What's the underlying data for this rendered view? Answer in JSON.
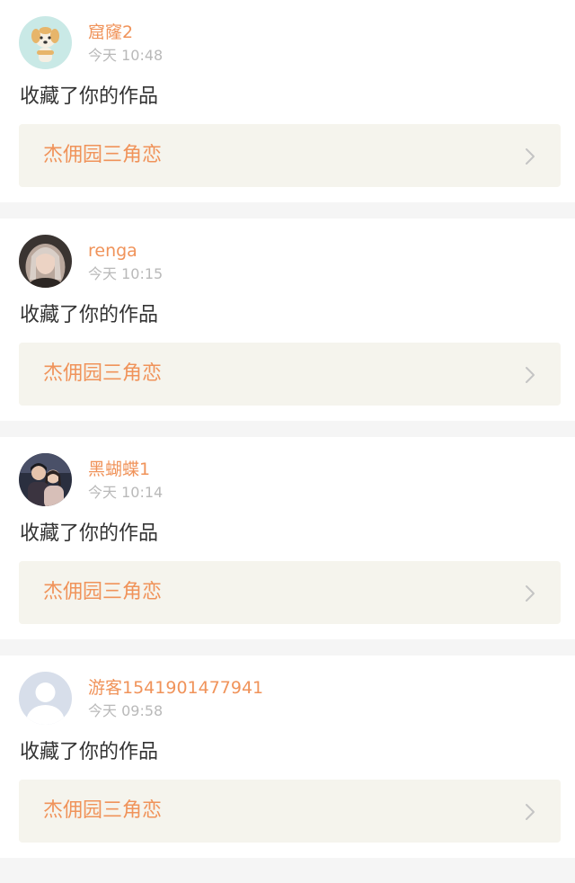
{
  "notifications": [
    {
      "username": "窟窿2",
      "timestamp": "今天 10:48",
      "action": "收藏了你的作品",
      "work_title": "杰佣园三角恋",
      "avatar_icon": "dog-avatar-icon"
    },
    {
      "username": "renga",
      "timestamp": "今天 10:15",
      "action": "收藏了你的作品",
      "work_title": "杰佣园三角恋",
      "avatar_icon": "girl-photo-avatar-icon"
    },
    {
      "username": "黑蝴蝶1",
      "timestamp": "今天 10:14",
      "action": "收藏了你的作品",
      "work_title": "杰佣园三角恋",
      "avatar_icon": "couple-photo-avatar-icon"
    },
    {
      "username": "游客1541901477941",
      "timestamp": "今天 09:58",
      "action": "收藏了你的作品",
      "work_title": "杰佣园三角恋",
      "avatar_icon": "default-user-avatar-icon"
    }
  ],
  "colors": {
    "accent": "#f0935a",
    "timestamp": "#b9b9b9",
    "text": "#333333",
    "link_bg": "#f5f4ed",
    "page_bg": "#f5f5f5"
  }
}
